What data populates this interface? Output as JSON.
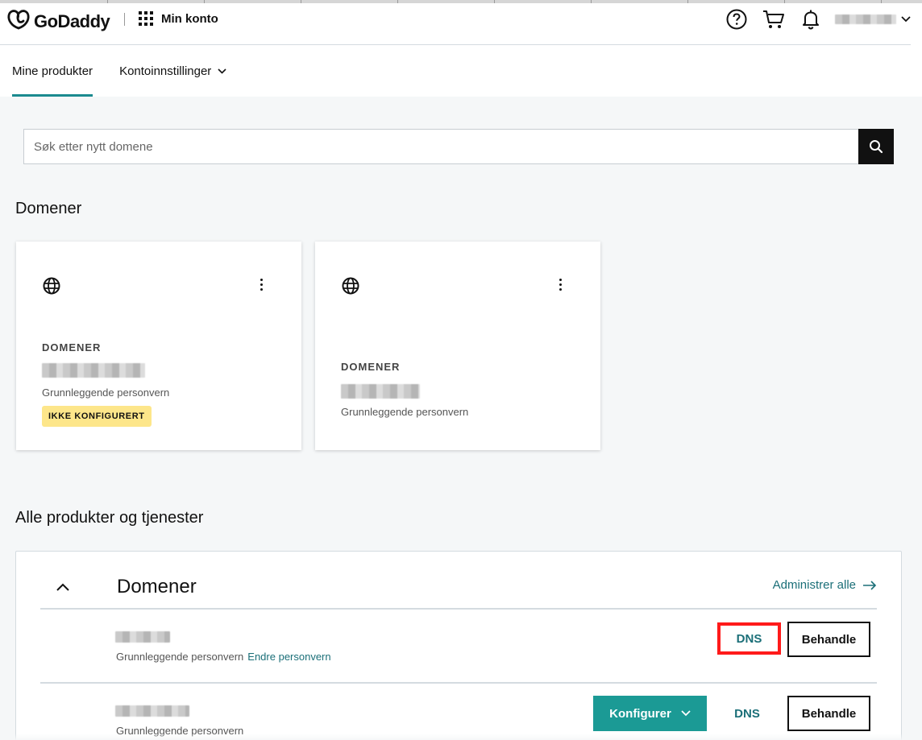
{
  "header": {
    "brand": "GoDaddy",
    "apps_label": "Min konto",
    "username": "user"
  },
  "subnav": {
    "products_tab": "Mine produkter",
    "account_settings_tab": "Kontoinnstillinger"
  },
  "search": {
    "placeholder": "Søk etter nytt domene"
  },
  "domains_section": {
    "heading": "Domener",
    "cards": [
      {
        "category": "DOMENER",
        "plan": "Grunnleggende personvern",
        "badge": "IKKE KONFIGURERT"
      },
      {
        "category": "DOMENER",
        "plan": "Grunnleggende personvern"
      }
    ]
  },
  "all_products": {
    "heading": "Alle produkter og tjenester",
    "panel_title": "Domener",
    "manage_all": "Administrer alle",
    "rows": [
      {
        "plan": "Grunnleggende personvern",
        "change_privacy": "Endre personvern",
        "dns": "DNS",
        "manage": "Behandle"
      },
      {
        "plan": "Grunnleggende personvern",
        "configure": "Konfigurer",
        "dns": "DNS",
        "manage": "Behandle"
      }
    ]
  },
  "colors": {
    "accent": "#1b8a8f",
    "teal_button": "#1b9a95",
    "badge_yellow": "#fde68a",
    "highlight_red": "#ff1a1a"
  },
  "icons": [
    "godaddy-logo-icon",
    "apps-grid-icon",
    "help-icon",
    "cart-icon",
    "bell-icon",
    "chevron-down-icon",
    "search-icon",
    "globe-icon",
    "kebab-menu-icon",
    "chevron-up-icon",
    "arrow-right-icon"
  ]
}
